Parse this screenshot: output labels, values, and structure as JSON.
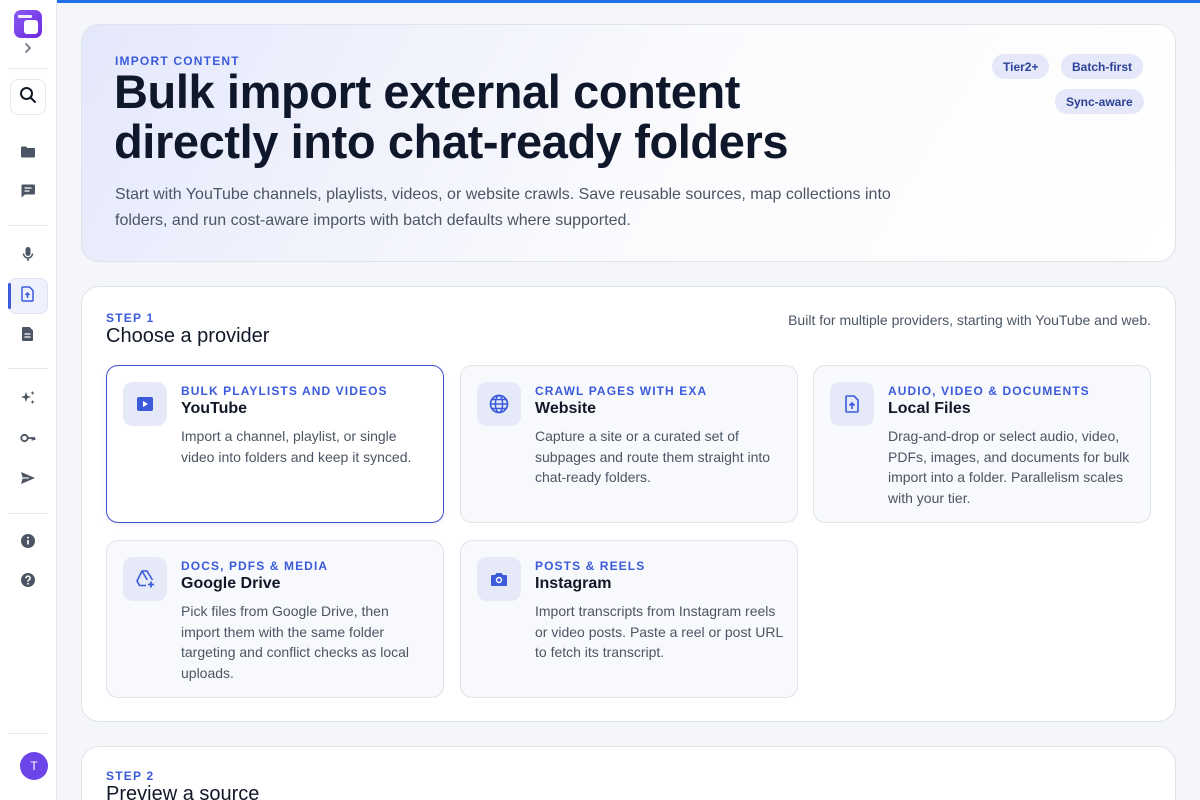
{
  "sidebar": {
    "avatar_initial": "T",
    "items": [
      {
        "name": "folders",
        "icon": "folder-icon"
      },
      {
        "name": "chat",
        "icon": "chat-icon"
      },
      {
        "name": "voice",
        "icon": "microphone-icon"
      },
      {
        "name": "import",
        "icon": "file-upload-icon",
        "active": true
      },
      {
        "name": "documents",
        "icon": "document-icon"
      },
      {
        "name": "ai-tools",
        "icon": "sparkles-icon"
      },
      {
        "name": "api-keys",
        "icon": "key-icon"
      },
      {
        "name": "send",
        "icon": "send-icon"
      },
      {
        "name": "info",
        "icon": "info-icon"
      },
      {
        "name": "help",
        "icon": "help-icon"
      }
    ]
  },
  "hero": {
    "eyebrow": "IMPORT CONTENT",
    "title_line1": "Bulk import external content",
    "title_line2": "directly into chat-ready folders",
    "desc_line1": "Start with YouTube channels, playlists, videos, or website crawls. Save reusable sources, map collections into",
    "desc_line2": "folders, and run cost-aware imports with batch defaults where supported.",
    "badges": [
      "Tier2+",
      "Batch-first",
      "Sync-aware"
    ]
  },
  "step1": {
    "eyebrow": "STEP 1",
    "title": "Choose a provider",
    "note": "Built for multiple providers, starting with YouTube and web.",
    "providers": [
      {
        "kicker": "BULK PLAYLISTS AND VIDEOS",
        "title": "YouTube",
        "desc": "Import a channel, playlist, or single video into folders and keep it synced.",
        "icon": "video-play-icon",
        "selected": true
      },
      {
        "kicker": "CRAWL PAGES WITH EXA",
        "title": "Website",
        "desc": "Capture a site or a curated set of subpages and route them straight into chat-ready folders.",
        "icon": "globe-icon",
        "selected": false
      },
      {
        "kicker": "AUDIO, VIDEO & DOCUMENTS",
        "title": "Local Files",
        "desc": "Drag-and-drop or select audio, video, PDFs, images, and documents for bulk import into a folder. Parallelism scales with your tier.",
        "icon": "file-upload-icon",
        "selected": false
      },
      {
        "kicker": "DOCS, PDFS & MEDIA",
        "title": "Google Drive",
        "desc": "Pick files from Google Drive, then import them with the same folder targeting and conflict checks as local uploads.",
        "icon": "drive-add-icon",
        "selected": false
      },
      {
        "kicker": "POSTS & REELS",
        "title": "Instagram",
        "desc": "Import transcripts from Instagram reels or video posts. Paste a reel or post URL to fetch its transcript.",
        "icon": "camera-icon",
        "selected": false
      }
    ]
  },
  "step2": {
    "eyebrow": "STEP 2",
    "title": "Preview a source"
  },
  "colors": {
    "accent": "#3b5bdb",
    "top_bar": "#1e6fe8",
    "avatar": "#6d44e8",
    "logo": "#7c3aed"
  }
}
